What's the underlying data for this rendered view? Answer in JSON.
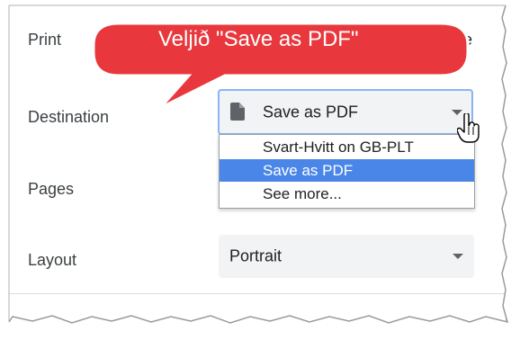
{
  "dialog": {
    "title": "Print",
    "title_right_partial": "e"
  },
  "callout": {
    "text": "Veljið \"Save as PDF\"",
    "color": "#e8383d"
  },
  "destination": {
    "label": "Destination",
    "selected": "Save as PDF",
    "icon": "document-icon",
    "options": [
      "Svart-Hvitt on GB-PLT",
      "Save as PDF",
      "See more..."
    ],
    "highlight_color": "#4a86e8"
  },
  "pages": {
    "label": "Pages"
  },
  "layout": {
    "label": "Layout",
    "selected": "Portrait"
  }
}
